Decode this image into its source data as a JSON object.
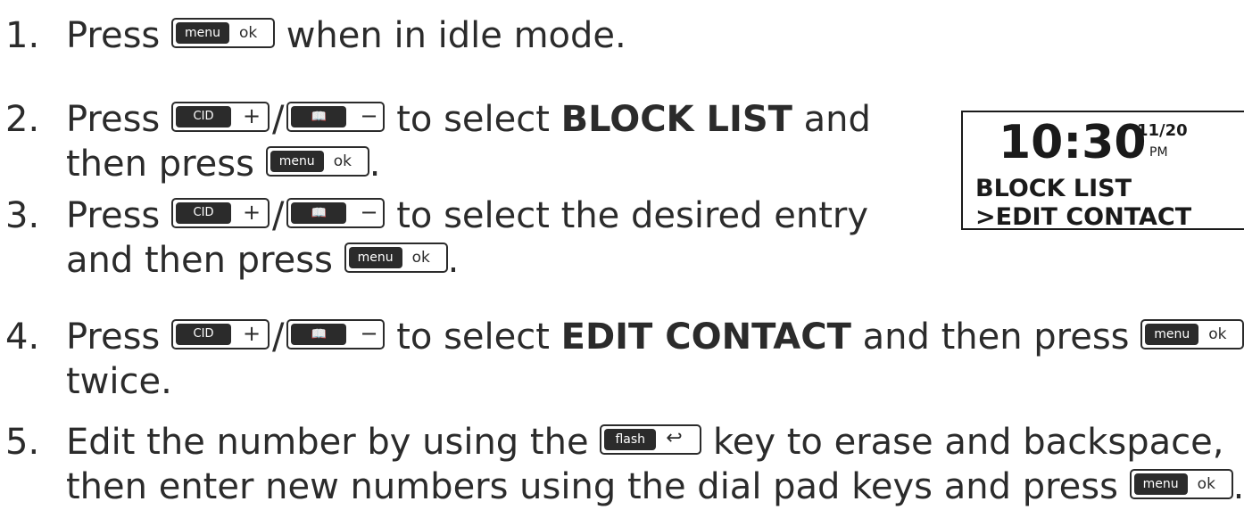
{
  "keys": {
    "menu": {
      "main": "menu",
      "sub": "ok"
    },
    "cid": {
      "main": "CID",
      "sub": "+"
    },
    "book": {
      "main": "📖",
      "sub": "−"
    },
    "flash": {
      "main": "flash",
      "sub": "↩"
    }
  },
  "steps": [
    {
      "num": "1.",
      "a": "Press",
      "b": "when in idle mode."
    },
    {
      "num": "2.",
      "a": "Press",
      "slash": "/",
      "b": "to select",
      "bold": "BLOCK LIST",
      "c": "and",
      "line2a": "then press",
      "end": "."
    },
    {
      "num": "3.",
      "a": "Press",
      "slash": "/",
      "b": "to select the desired entry",
      "line2a": "and then press",
      "end": "."
    },
    {
      "num": "4.",
      "a": "Press",
      "slash": "/",
      "b": "to select",
      "bold": "EDIT CONTACT",
      "c": "and then press",
      "line2a": "twice."
    },
    {
      "num": "5.",
      "a": "Edit the number by using the",
      "b": "key to erase and backspace,",
      "line2a": "then enter new numbers using the dial pad keys and press",
      "end": "."
    }
  ],
  "lcd": {
    "time": "10:30",
    "date": "11/20",
    "ampm": "PM",
    "line1": "BLOCK LIST",
    "line2": ">EDIT CONTACT"
  }
}
